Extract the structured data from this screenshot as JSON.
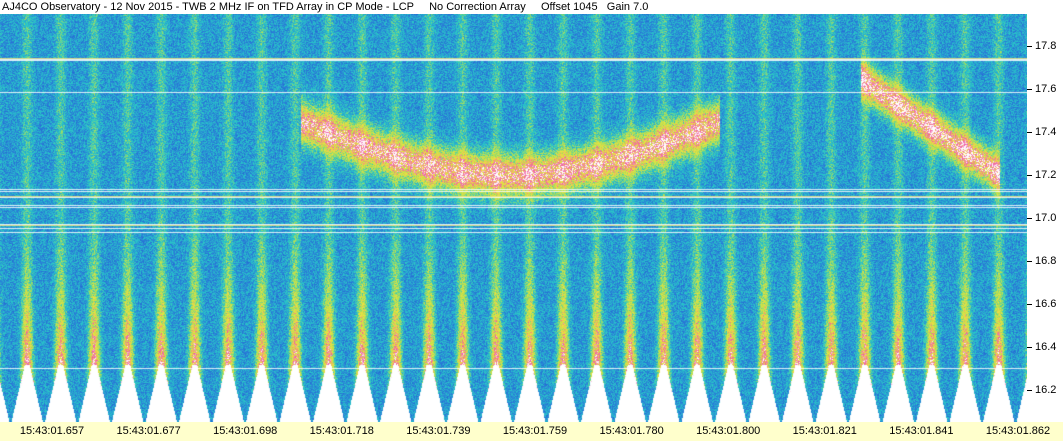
{
  "title": "AJ4CO Observatory - 12 Nov 2015 - TWB 2 MHz IF on TFD Array in CP Mode - LCP     No Correction Array     Offset 1045   Gain 7.0",
  "chart_data": {
    "type": "heatmap",
    "title": "AJ4CO Observatory - 12 Nov 2015 - TWB 2 MHz IF on TFD Array in CP Mode - LCP     No Correction Array     Offset 1045   Gain 7.0",
    "x_ticks": [
      "15:43:01.657",
      "15:43:01.677",
      "15:43:01.698",
      "15:43:01.718",
      "15:43:01.739",
      "15:43:01.759",
      "15:43:01.780",
      "15:43:01.800",
      "15:43:01.821",
      "15:43:01.841",
      "15:43:01.862"
    ],
    "y_ticks": [
      17.8,
      17.6,
      17.4,
      17.2,
      17.0,
      16.8,
      16.6,
      16.4,
      16.2
    ],
    "ylim": [
      16.05,
      17.95
    ],
    "colormap": [
      "#1a3fc4",
      "#2a7fd8",
      "#28c8c8",
      "#b8e050",
      "#f0e040",
      "#ee5aa6",
      "#ffffff"
    ],
    "grid": false
  }
}
